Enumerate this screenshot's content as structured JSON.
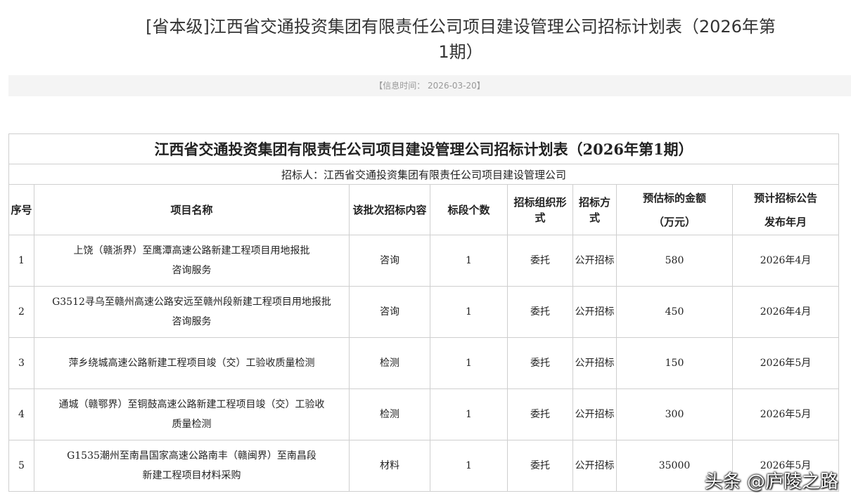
{
  "page": {
    "title": "[省本级]江西省交通投资集团有限责任公司项目建设管理公司招标计划表（2026年第\n1期）",
    "info_time": "【信息时间： 2026-03-20】"
  },
  "table": {
    "title": "江西省交通投资集团有限责任公司项目建设管理公司招标计划表（2026年第1期）",
    "tenderer": "招标人：江西省交通投资集团有限责任公司项目建设管理公司",
    "headers": {
      "seq": "序号",
      "name": "项目名称",
      "content": "该批次招标内容",
      "sections": "标段个数",
      "org": "招标组织形式",
      "method": "招标方式",
      "amount": "预估标的金额\n（万元）",
      "publish": "预计招标公告\n发布年月"
    },
    "rows": [
      {
        "seq": "1",
        "name": "上饶（赣浙界）至鹰潭高速公路新建工程项目用地报批\n咨询服务",
        "content": "咨询",
        "sections": "1",
        "org": "委托",
        "method": "公开招标",
        "amount": "580",
        "publish": "2026年4月"
      },
      {
        "seq": "2",
        "name": "G3512寻乌至赣州高速公路安远至赣州段新建工程项目用地报批\n咨询服务",
        "content": "咨询",
        "sections": "1",
        "org": "委托",
        "method": "公开招标",
        "amount": "450",
        "publish": "2026年4月"
      },
      {
        "seq": "3",
        "name": "萍乡绕城高速公路新建工程项目竣（交）工验收质量检测",
        "content": "检测",
        "sections": "1",
        "org": "委托",
        "method": "公开招标",
        "amount": "150",
        "publish": "2026年5月"
      },
      {
        "seq": "4",
        "name": "通城（赣鄂界）至铜鼓高速公路新建工程项目竣（交）工验收\n质量检测",
        "content": "检测",
        "sections": "1",
        "org": "委托",
        "method": "公开招标",
        "amount": "300",
        "publish": "2026年5月"
      },
      {
        "seq": "5",
        "name": "G1535潮州至南昌国家高速公路南丰（赣闽界）至南昌段\n新建工程项目材料采购",
        "content": "材料",
        "sections": "1",
        "org": "委托",
        "method": "公开招标",
        "amount": "35000",
        "publish": "2026年5月"
      }
    ]
  },
  "watermark": "头条 @庐陵之路"
}
